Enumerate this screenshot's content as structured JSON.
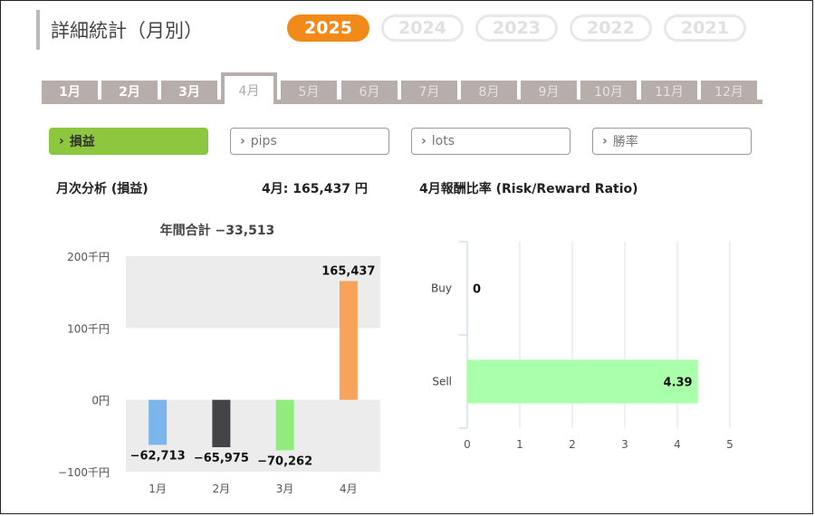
{
  "header": {
    "title": "詳細統計（月別）"
  },
  "years": [
    {
      "label": "2025",
      "active": true
    },
    {
      "label": "2024",
      "active": false
    },
    {
      "label": "2023",
      "active": false
    },
    {
      "label": "2022",
      "active": false
    },
    {
      "label": "2021",
      "active": false
    }
  ],
  "months": [
    "1月",
    "2月",
    "3月",
    "4月",
    "5月",
    "6月",
    "7月",
    "8月",
    "9月",
    "10月",
    "11月",
    "12月"
  ],
  "selected_month": "4月",
  "metrics": [
    {
      "label": "損益",
      "active": true
    },
    {
      "label": "pips",
      "active": false
    },
    {
      "label": "lots",
      "active": false
    },
    {
      "label": "勝率",
      "active": false
    }
  ],
  "summary": {
    "monthly_label": "月次分析 (損益)",
    "month_total": "4月:  165,437 円",
    "ratio_title": "4月報酬比率 (Risk/Reward Ratio)"
  },
  "chart_data": [
    {
      "type": "bar",
      "title": "年間合計 −33,513",
      "categories": [
        "1月",
        "2月",
        "3月",
        "4月"
      ],
      "values": [
        -62713,
        -65975,
        -70262,
        165437
      ],
      "value_labels": [
        "−62,713",
        "−65,975",
        "−70,262",
        "165,437"
      ],
      "colors": [
        "#7cb5ec",
        "#434348",
        "#90ed7d",
        "#f7a35c"
      ],
      "y_ticks": [
        200000,
        100000,
        0,
        -100000
      ],
      "y_tick_labels": [
        "200千円",
        "100千円",
        "0円",
        "−100千円"
      ],
      "ylim": [
        -100000,
        200000
      ],
      "grid": "alternating bands"
    },
    {
      "type": "bar",
      "orientation": "horizontal",
      "categories": [
        "Buy",
        "Sell"
      ],
      "values": [
        0,
        4.39
      ],
      "value_labels": [
        "0",
        "4.39"
      ],
      "color": "#aaffaa",
      "x_ticks": [
        "0",
        "1",
        "2",
        "3",
        "4",
        "5"
      ],
      "xlim": [
        0,
        5
      ],
      "grid": "vertical lines"
    }
  ]
}
